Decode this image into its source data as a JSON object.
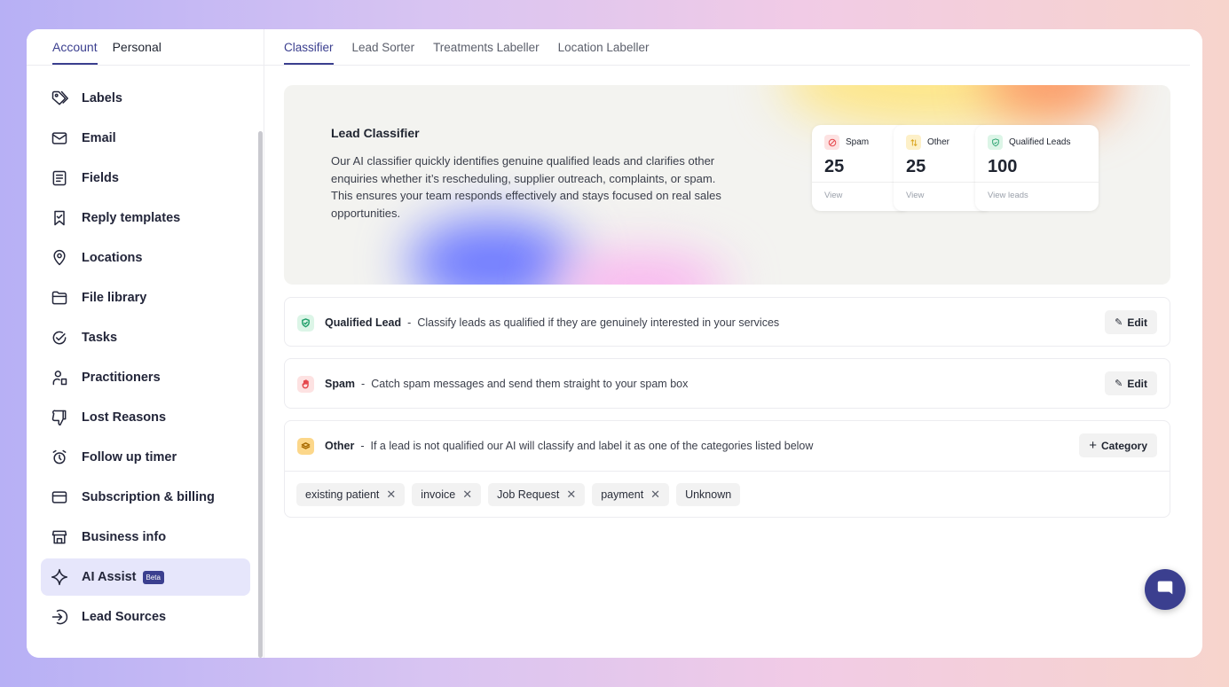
{
  "sidebar": {
    "tabs": [
      {
        "label": "Account",
        "active": true
      },
      {
        "label": "Personal",
        "active": false
      }
    ],
    "items": [
      {
        "label": "Labels",
        "icon": "tag-icon"
      },
      {
        "label": "Email",
        "icon": "mail-icon"
      },
      {
        "label": "Fields",
        "icon": "fields-icon"
      },
      {
        "label": "Reply templates",
        "icon": "bookmark-icon"
      },
      {
        "label": "Locations",
        "icon": "location-pin-icon"
      },
      {
        "label": "File library",
        "icon": "folder-icon"
      },
      {
        "label": "Tasks",
        "icon": "check-circle-icon"
      },
      {
        "label": "Practitioners",
        "icon": "user-icon"
      },
      {
        "label": "Lost Reasons",
        "icon": "thumbs-down-icon"
      },
      {
        "label": "Follow up timer",
        "icon": "alarm-clock-icon"
      },
      {
        "label": "Subscription & billing",
        "icon": "credit-card-icon"
      },
      {
        "label": "Business info",
        "icon": "store-icon"
      },
      {
        "label": "AI Assist",
        "icon": "sparkle-icon",
        "badge": "Beta",
        "active": true
      },
      {
        "label": "Lead Sources",
        "icon": "sign-in-icon"
      }
    ]
  },
  "main": {
    "tabs": [
      {
        "label": "Classifier",
        "active": true
      },
      {
        "label": "Lead Sorter",
        "active": false
      },
      {
        "label": "Treatments Labeller",
        "active": false
      },
      {
        "label": "Location Labeller",
        "active": false
      }
    ],
    "hero": {
      "title": "Lead Classifier",
      "description": "Our AI classifier quickly identifies genuine qualified leads and clarifies other enquiries whether it’s rescheduling, supplier outreach, complaints, or spam. This ensures your team responds effectively and stays focused on real sales opportunities."
    },
    "stats": [
      {
        "label": "Spam",
        "value": "25",
        "link": "View",
        "icon": "ban-icon",
        "color": "#e5484d"
      },
      {
        "label": "Other",
        "value": "25",
        "link": "View",
        "icon": "split-icon",
        "color": "#d9a21b"
      },
      {
        "label": "Qualified Leads",
        "value": "100",
        "link": "View leads",
        "icon": "shield-check-icon",
        "color": "#22a06b"
      }
    ],
    "rows": [
      {
        "name": "Qualified Lead",
        "sep": "-",
        "description": "Classify leads as qualified if they are genuinely interested in your services",
        "button": "Edit",
        "icon": "shield-check-icon"
      },
      {
        "name": "Spam",
        "sep": "-",
        "description": "Catch spam messages and send them straight to your spam box",
        "button": "Edit",
        "icon": "hand-icon"
      },
      {
        "name": "Other",
        "sep": "-",
        "description": "If a lead is not qualified our AI will classify and label it as one of the categories listed below",
        "button": "Category",
        "icon": "layers-icon"
      }
    ],
    "categories": [
      {
        "label": "existing patient",
        "removable": true
      },
      {
        "label": "invoice",
        "removable": true
      },
      {
        "label": "Job Request",
        "removable": true
      },
      {
        "label": "payment",
        "removable": true
      },
      {
        "label": "Unknown",
        "removable": false
      }
    ]
  },
  "colors": {
    "accent": "#3b3f8f",
    "active_bg": "#e6e6fb"
  }
}
